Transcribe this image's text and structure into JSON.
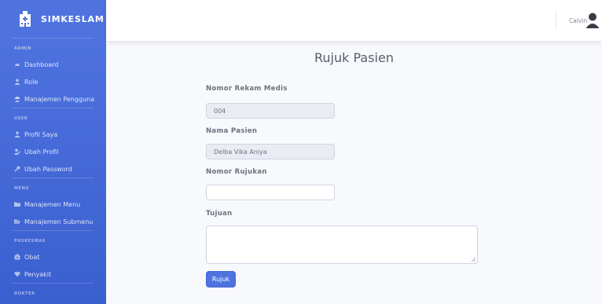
{
  "brand": {
    "name": "SIMKESLAM",
    "icon": "hospital-icon"
  },
  "sidebar": {
    "sections": [
      {
        "heading": "ADMIN",
        "items": [
          {
            "label": "Dashboard",
            "icon": "tachometer-icon"
          },
          {
            "label": "Role",
            "icon": "user-icon"
          },
          {
            "label": "Manajemen Pengguna",
            "icon": "users-icon"
          }
        ]
      },
      {
        "heading": "USER",
        "items": [
          {
            "label": "Profil Saya",
            "icon": "user-icon"
          },
          {
            "label": "Ubah Profil",
            "icon": "user-edit-icon"
          },
          {
            "label": "Ubah Password",
            "icon": "key-icon"
          }
        ]
      },
      {
        "heading": "MENU",
        "items": [
          {
            "label": "Manajemen Menu",
            "icon": "folder-icon"
          },
          {
            "label": "Manajemen Submenu",
            "icon": "folder-open-icon"
          }
        ]
      },
      {
        "heading": "PUSKESMAS",
        "items": [
          {
            "label": "Obat",
            "icon": "medkit-icon"
          },
          {
            "label": "Penyakit",
            "icon": "heart-icon"
          }
        ]
      },
      {
        "heading": "DOKTER",
        "items": []
      }
    ]
  },
  "topbar": {
    "user_name": "Calvin",
    "user_icon": "user-circle-icon"
  },
  "page": {
    "title": "Rujuk Pasien",
    "fields": {
      "rekam_medis": {
        "label": "Nomor Rekam Medis",
        "value": "004"
      },
      "nama_pasien": {
        "label": "Nama Pasien",
        "value": "Delba Vika Aniya"
      },
      "nomor_rujukan": {
        "label": "Nomor Rujukan",
        "value": ""
      },
      "tujuan": {
        "label": "Tujuan",
        "value": ""
      }
    },
    "submit_label": "Rujuk"
  },
  "colors": {
    "primary": "#4e73df",
    "background": "#f8f9fc"
  }
}
